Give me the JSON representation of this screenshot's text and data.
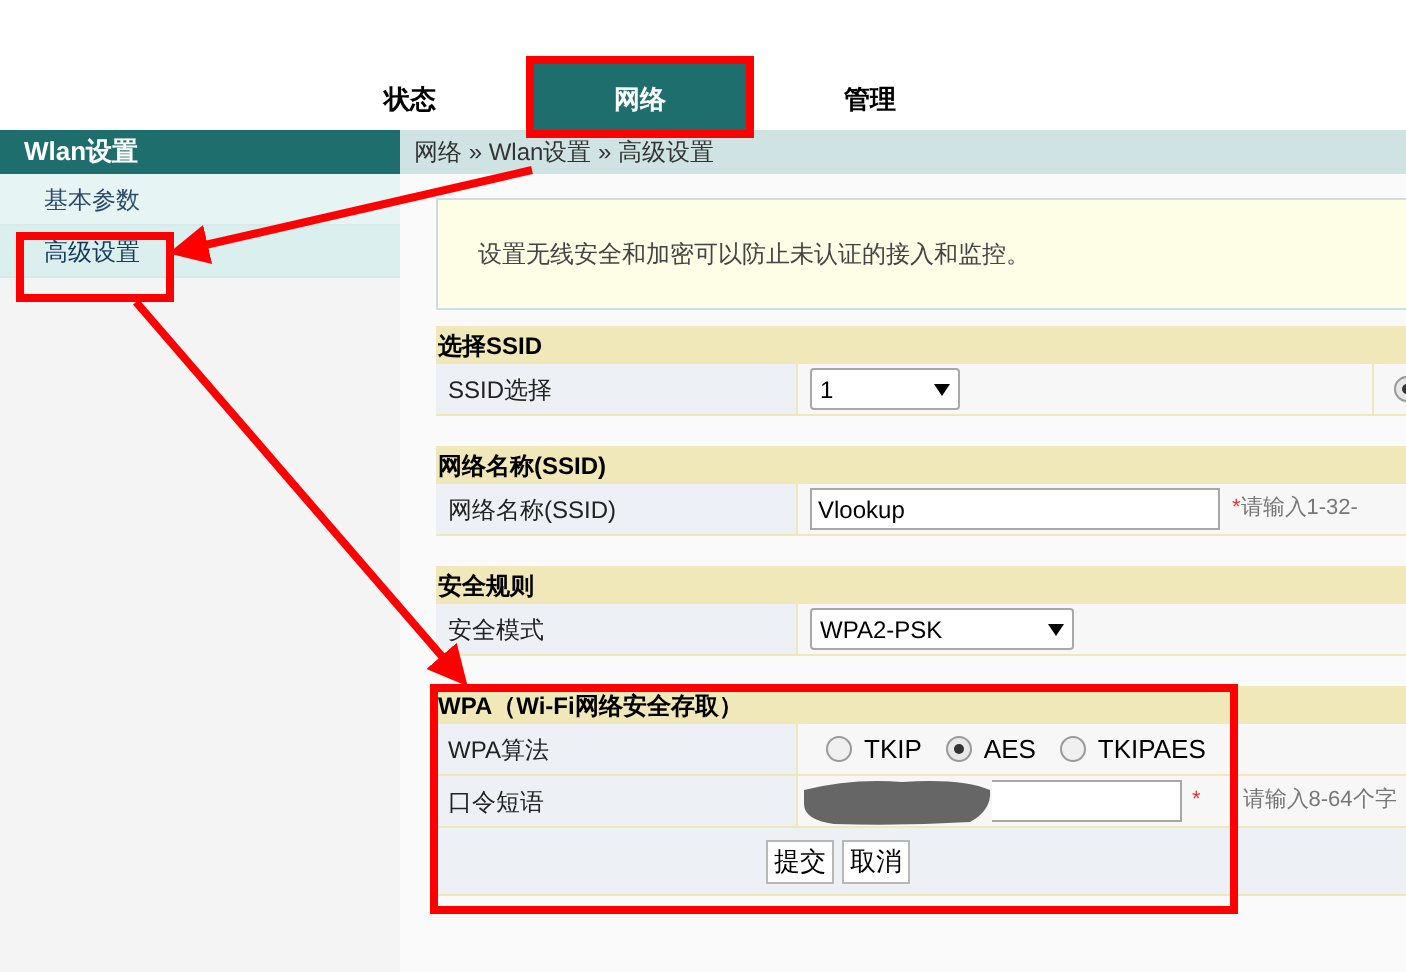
{
  "nav_tabs": [
    {
      "label": "状态",
      "selected": false
    },
    {
      "label": "网络",
      "selected": true
    },
    {
      "label": "管理",
      "selected": false
    }
  ],
  "sidebar": {
    "title": "Wlan设置",
    "items": [
      {
        "label": "基本参数",
        "selected": false
      },
      {
        "label": "高级设置",
        "selected": true
      }
    ]
  },
  "breadcrumb": "网络 » Wlan设置 » 高级设置",
  "notice": "设置无线安全和加密可以防止未认证的接入和监控。",
  "sections": [
    {
      "title": "选择SSID",
      "rows": [
        {
          "kind": "select",
          "label": "SSID选择",
          "value": "1",
          "side_radio": {
            "selected": true
          }
        }
      ]
    },
    {
      "title": "网络名称(SSID)",
      "rows": [
        {
          "kind": "text",
          "label": "网络名称(SSID)",
          "value": "Vlookup",
          "required_mark": "*",
          "hint": "请输入1-32-"
        }
      ]
    },
    {
      "title": "安全规则",
      "rows": [
        {
          "kind": "select",
          "label": "安全模式",
          "value": "WPA2-PSK"
        }
      ]
    },
    {
      "title": "WPA（Wi-Fi网络安全存取）",
      "rows": [
        {
          "kind": "radio",
          "label": "WPA算法",
          "options": [
            {
              "label": "TKIP",
              "selected": false
            },
            {
              "label": "AES",
              "selected": true
            },
            {
              "label": "TKIPAES",
              "selected": false
            }
          ]
        },
        {
          "kind": "password",
          "label": "口令短语",
          "required_mark": "*",
          "hint": "请输入8-64个字"
        },
        {
          "kind": "buttons",
          "buttons": [
            "提交",
            "取消"
          ]
        }
      ]
    }
  ]
}
